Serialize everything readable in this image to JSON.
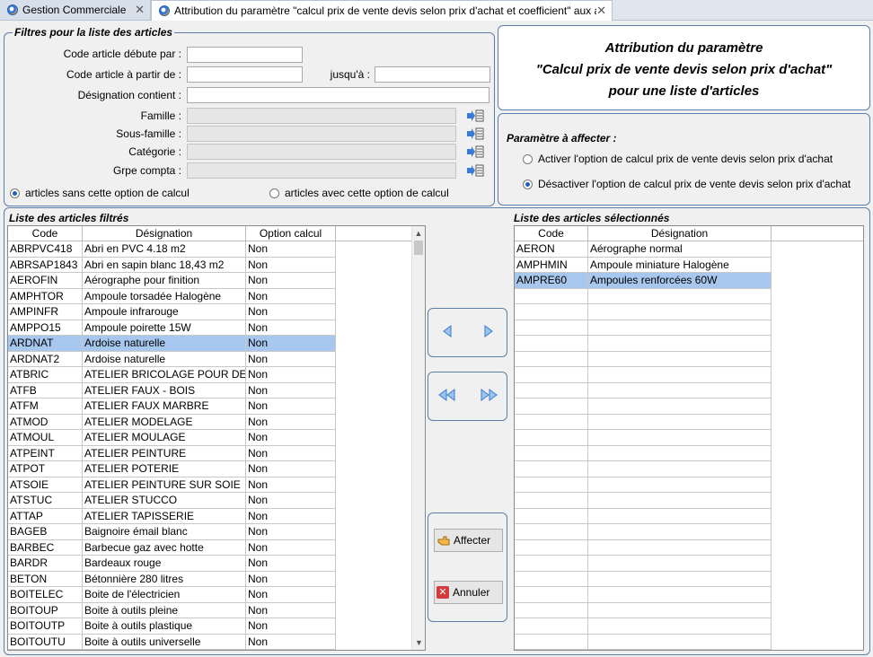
{
  "tabs": [
    {
      "label": "Gestion Commerciale"
    },
    {
      "label": "Attribution du paramètre \"calcul prix de vente devis selon prix d'achat et coefficient\" aux articl"
    }
  ],
  "filters": {
    "title": "Filtres pour la liste des articles",
    "code_starts_label": "Code article débute par :",
    "code_from_label": "Code article à partir de :",
    "code_to_label": "jusqu'à :",
    "designation_label": "Désignation contient :",
    "famille_label": "Famille :",
    "sous_famille_label": "Sous-famille :",
    "categorie_label": "Catégorie :",
    "grpe_compta_label": "Grpe compta :",
    "radio_without": "articles sans cette option de calcul",
    "radio_with": "articles avec cette option de calcul",
    "values": {
      "code_starts": "",
      "code_from": "",
      "code_to": "",
      "designation": "",
      "famille": "",
      "sous_famille": "",
      "categorie": "",
      "grpe_compta": ""
    }
  },
  "header": {
    "line1": "Attribution du paramètre",
    "line2": "\"Calcul prix de vente devis selon prix d'achat\"",
    "line3": "pour une liste d'articles"
  },
  "param": {
    "title": "Paramètre à affecter :",
    "option_activate": "Activer l'option de calcul prix de vente devis selon prix d'achat",
    "option_deactivate": "Désactiver l'option de calcul prix de vente devis selon prix d'achat"
  },
  "left_list": {
    "title": "Liste des articles filtrés",
    "columns": [
      "Code",
      "Désignation",
      "Option calcul"
    ],
    "rows": [
      [
        "ABRPVC418",
        "Abri en PVC 4.18 m2",
        "Non"
      ],
      [
        "ABRSAP1843",
        "Abri en sapin blanc 18,43 m2",
        "Non"
      ],
      [
        "AEROFIN",
        "Aérographe pour finition",
        "Non"
      ],
      [
        "AMPHTOR",
        "Ampoule torsadée Halogène",
        "Non"
      ],
      [
        "AMPINFR",
        "Ampoule infrarouge",
        "Non"
      ],
      [
        "AMPPO15",
        "Ampoule poirette 15W",
        "Non"
      ],
      [
        "ARDNAT",
        "Ardoise naturelle",
        "Non"
      ],
      [
        "ARDNAT2",
        "Ardoise naturelle",
        "Non"
      ],
      [
        "ATBRIC",
        "ATELIER BRICOLAGE POUR DEB",
        "Non"
      ],
      [
        "ATFB",
        "ATELIER FAUX - BOIS",
        "Non"
      ],
      [
        "ATFM",
        "ATELIER FAUX MARBRE",
        "Non"
      ],
      [
        "ATMOD",
        "ATELIER MODELAGE",
        "Non"
      ],
      [
        "ATMOUL",
        "ATELIER MOULAGE",
        "Non"
      ],
      [
        "ATPEINT",
        "ATELIER PEINTURE",
        "Non"
      ],
      [
        "ATPOT",
        "ATELIER POTERIE",
        "Non"
      ],
      [
        "ATSOIE",
        "ATELIER PEINTURE SUR SOIE",
        "Non"
      ],
      [
        "ATSTUC",
        "ATELIER STUCCO",
        "Non"
      ],
      [
        "ATTAP",
        "ATELIER TAPISSERIE",
        "Non"
      ],
      [
        "BAGEB",
        "Baignoire émail blanc",
        "Non"
      ],
      [
        "BARBEC",
        "Barbecue gaz avec hotte",
        "Non"
      ],
      [
        "BARDR",
        "Bardeaux rouge",
        "Non"
      ],
      [
        "BETON",
        "Bétonnière 280 litres",
        "Non"
      ],
      [
        "BOITELEC",
        "Boite de l'électricien",
        "Non"
      ],
      [
        "BOITOUP",
        "Boite à outils pleine",
        "Non"
      ],
      [
        "BOITOUTP",
        "Boite à outils plastique",
        "Non"
      ],
      [
        "BOITOUTU",
        "Boite à outils universelle",
        "Non"
      ]
    ]
  },
  "right_list": {
    "title": "Liste des articles sélectionnés",
    "columns": [
      "Code",
      "Désignation"
    ],
    "rows": [
      [
        "AERON",
        "Aérographe normal"
      ],
      [
        "AMPHMIN",
        "Ampoule miniature Halogène"
      ],
      [
        "AMPRE60",
        "Ampoules renforcées 60W"
      ]
    ]
  },
  "buttons": {
    "affecter": "Affecter",
    "annuler": "Annuler"
  },
  "colors": {
    "selection": "#a7c7ee",
    "group_border": "#5b7fa8",
    "disabled_field": "#e6e6e6"
  }
}
